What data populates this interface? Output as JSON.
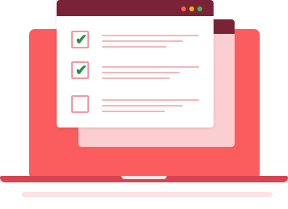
{
  "colors": {
    "screen": "#fb5c5d",
    "base": "#d64452",
    "shadow": "#fde1e3",
    "panel": "#fbcfd2",
    "dark": "#7a2336",
    "check": "#2a8f3a",
    "line": "#f4b7bd",
    "dot_red": "#ff5a4f",
    "dot_yellow": "#f4b000",
    "dot_green": "#41c04b"
  },
  "checklist": {
    "items": [
      {
        "checked": true,
        "icon": "checkmark-icon"
      },
      {
        "checked": true,
        "icon": "checkmark-icon"
      },
      {
        "checked": false,
        "icon": "empty-checkbox-icon"
      }
    ]
  }
}
